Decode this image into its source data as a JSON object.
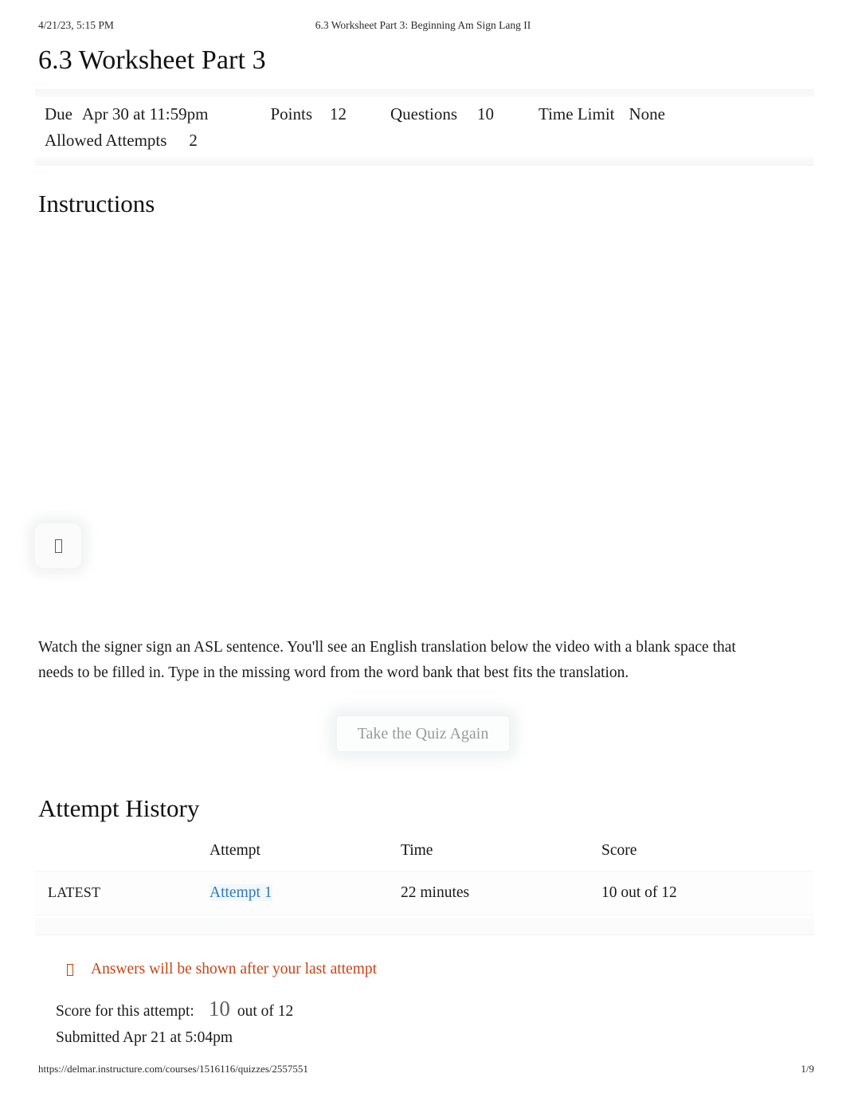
{
  "print_header": {
    "timestamp": "4/21/23, 5:15 PM",
    "document_title": "6.3 Worksheet Part 3: Beginning Am Sign Lang II"
  },
  "quiz": {
    "title": "6.3 Worksheet Part 3",
    "details": {
      "due_label": "Due",
      "due_value": "Apr 30 at 11:59pm",
      "points_label": "Points",
      "points_value": "12",
      "questions_label": "Questions",
      "questions_value": "10",
      "time_limit_label": "Time Limit",
      "time_limit_value": "None",
      "allowed_attempts_label": "Allowed Attempts",
      "allowed_attempts_value": "2"
    }
  },
  "instructions": {
    "heading": "Instructions",
    "media_icon": "missing-glyph-box",
    "body": "Watch the signer sign an ASL sentence. You'll see an English translation below the video with a blank space that needs to be filled in. Type in the missing word from the word bank that best fits the translation."
  },
  "actions": {
    "retake_label": "Take the Quiz Again"
  },
  "attempt_history": {
    "heading": "Attempt History",
    "columns": [
      "",
      "Attempt",
      "Time",
      "Score"
    ],
    "rows": [
      {
        "kept": "LATEST",
        "attempt": "Attempt 1",
        "time": "22 minutes",
        "score": "10 out of 12"
      }
    ]
  },
  "answers_notice": {
    "icon": "missing-glyph-box",
    "text": "Answers will be shown after your last attempt"
  },
  "score_summary": {
    "label": "Score for this attempt:",
    "value": "10",
    "out_of": "out of 12",
    "submitted": "Submitted Apr 21 at 5:04pm"
  },
  "print_footer": {
    "url": "https://delmar.instructure.com/courses/1516116/quizzes/2557551",
    "page": "1/9"
  },
  "colors": {
    "link": "#2b7bbd",
    "warning": "#c44417",
    "text": "#1a1a1a",
    "muted": "#9a9a9a"
  }
}
